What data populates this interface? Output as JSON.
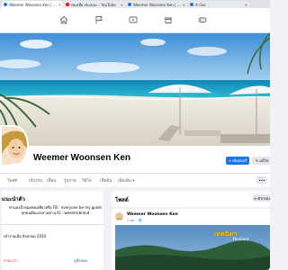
{
  "browser": {
    "tabs": [
      {
        "label": "Weemer Woonsen Ken | Facebook",
        "active": true,
        "favicon": "facebook-icon"
      },
      {
        "label": "ท่องเที่ยวกับเหมะ - YouTube",
        "active": false,
        "favicon": "youtube-icon"
      },
      {
        "label": "Weemer Woonsen Ken | Facebook",
        "active": false,
        "favicon": "facebook-icon"
      },
      {
        "label": "ลำโพง",
        "active": false,
        "favicon": "facebook-icon"
      }
    ]
  },
  "nav": {
    "icons": [
      "home-icon",
      "flag-icon",
      "watch-icon",
      "marketplace-icon",
      "gaming-icon"
    ],
    "accent": "#1877f2"
  },
  "profile": {
    "name": "Weemer Woonsen Ken",
    "add_story_label": "+ เพิ่มสตอรี่",
    "edit_label": "✎ แก้ไข"
  },
  "tabs": {
    "items": [
      "โพสต์",
      "เกี่ยวกับ",
      "เพื่อน",
      "รูปภาพ",
      "วิดีโอ",
      "เช็คอิน",
      "เพิ่มเติม ▾"
    ],
    "more": "•••"
  },
  "intro": {
    "title": "แนะนำตัว",
    "bio": "ท่านลงน้ำหมดท่องเที่ยวหรือ FB : everyone be my guest ทุกคนคือแขกสามท่าน IG : weemerbrand",
    "joined": "เข้าร่วมเมื่อ สิงหาคม 2010",
    "link_left": "หาดเวลา",
    "link_right": "ดูทั้งหมด"
  },
  "posts": {
    "title": "โพสต์",
    "filter_label": "≡ ตัวกรอง",
    "post": {
      "author": "Weemer Woonsen Ken",
      "time": "1 ชม. · 🌐",
      "image_title": "เทคนิคฯ",
      "image_subtitle": "Thailand"
    }
  },
  "colors": {
    "fb_blue": "#1877f2",
    "page_bg": "#f0f2f5",
    "sea": "#1ea7c7",
    "sky": "#5aa3e0"
  }
}
